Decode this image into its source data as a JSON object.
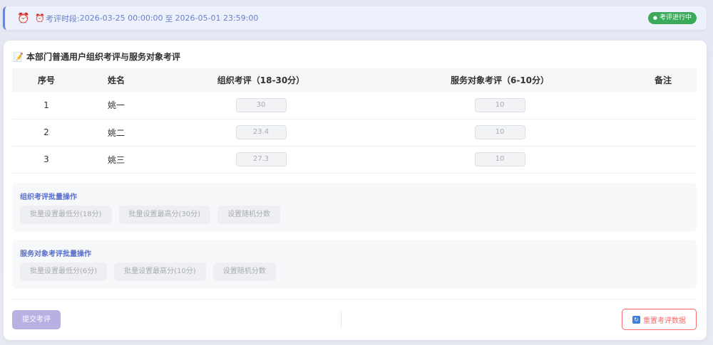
{
  "banner": {
    "period_label": "考评时段:",
    "period_start": "2026-03-25 00:00:00",
    "period_sep": "至",
    "period_end": "2026-05-01 23:59:00",
    "status": "考评进行中",
    "status_color": "#3aa95a",
    "icons": [
      "alarm-clock-icon",
      "alarm-clock-icon"
    ]
  },
  "card": {
    "title": "本部门普通用户组织考评与服务对象考评",
    "title_icon": "memo-icon"
  },
  "table": {
    "headers": [
      "序号",
      "姓名",
      "组织考评（18-30分）",
      "服务对象考评（6-10分）",
      "备注"
    ],
    "rows": [
      {
        "no": "1",
        "name": "姚一",
        "org": "30",
        "svc": "10",
        "note": ""
      },
      {
        "no": "2",
        "name": "姚二",
        "org": "23.4",
        "svc": "10",
        "note": ""
      },
      {
        "no": "3",
        "name": "姚三",
        "org": "27.3",
        "svc": "10",
        "note": ""
      }
    ]
  },
  "org_batch": {
    "title": "组织考评批量操作",
    "buttons": [
      "批量设置最低分(18分)",
      "批量设置最高分(30分)",
      "设置随机分数"
    ]
  },
  "svc_batch": {
    "title": "服务对象考评批量操作",
    "buttons": [
      "批量设置最低分(6分)",
      "批量设置最高分(10分)",
      "设置随机分数"
    ]
  },
  "footer": {
    "submit_label": "提交考评",
    "reset_label": "重置考评数据",
    "accent": "#b7b1e2",
    "danger": "#f56c6c"
  }
}
